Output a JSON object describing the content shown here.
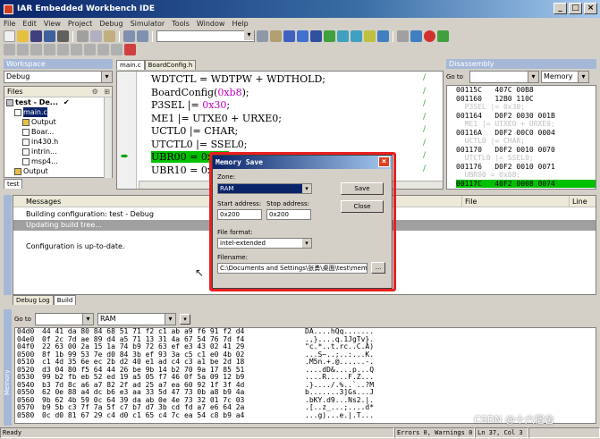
{
  "window": {
    "title": "IAR Embedded Workbench IDE"
  },
  "menu": [
    "File",
    "Edit",
    "View",
    "Project",
    "Debug",
    "Simulator",
    "Tools",
    "Window",
    "Help"
  ],
  "workspace": {
    "title": "Workspace",
    "config": "Debug",
    "files_header": "Files",
    "tree": [
      {
        "label": "test - De...",
        "indent": 0,
        "icon": "project-icon",
        "check": "✔"
      },
      {
        "label": "main.c",
        "indent": 1,
        "icon": "file-icon",
        "selected": true
      },
      {
        "label": "Output",
        "indent": 2,
        "icon": "folder-icon"
      },
      {
        "label": "Boar...",
        "indent": 2,
        "icon": "file-icon"
      },
      {
        "label": "in430.h",
        "indent": 2,
        "icon": "file-icon"
      },
      {
        "label": "intrin...",
        "indent": 2,
        "icon": "file-icon"
      },
      {
        "label": "msp4...",
        "indent": 2,
        "icon": "file-icon"
      },
      {
        "label": "Output",
        "indent": 1,
        "icon": "folder-icon"
      }
    ],
    "bottom_tab": "test"
  },
  "editor": {
    "tabs": [
      "main.c",
      "BoardConfig.h"
    ],
    "lines": [
      {
        "pre": "WDTCTL = WDTPW + WDTHOLD;",
        "num": "",
        "post": ""
      },
      {
        "pre": "BoardConfig(",
        "num": "0xb8",
        "post": ");"
      },
      {
        "pre": "P3SEL |= ",
        "num": "0x30",
        "post": ";"
      },
      {
        "pre": "ME1 |= UTXE0 + URXE0;",
        "num": "",
        "post": ""
      },
      {
        "pre": "UCTL0 |= CHAR;",
        "num": "",
        "post": ""
      },
      {
        "pre": "UTCTL0 |= SSEL0;",
        "num": "",
        "post": ""
      },
      {
        "pre": "UBR00 = 0x08;",
        "num": "",
        "post": ""
      },
      {
        "pre": "UBR10 = 0x00;",
        "num": "",
        "post": ""
      }
    ]
  },
  "disassembly": {
    "title": "Disassembly",
    "goto_label": "Go to",
    "memory_label": "Memory",
    "lines": [
      {
        "text": "00115C   407C 00B8",
        "kind": "code"
      },
      {
        "text": "001160   12B0 110C",
        "kind": "code"
      },
      {
        "text": "  P3SEL |= 0x30;",
        "kind": "src"
      },
      {
        "text": "001164   D0F2 0030 001B",
        "kind": "code"
      },
      {
        "text": "  ME1 |= UTXE0 + URXE0;",
        "kind": "src"
      },
      {
        "text": "00116A   D0F2 00C0 0004",
        "kind": "code"
      },
      {
        "text": "  UCTL0 |= CHAR;",
        "kind": "src"
      },
      {
        "text": "001170   D0F2 0010 0070",
        "kind": "code"
      },
      {
        "text": "  UTCTL0 |= SSEL0;",
        "kind": "src"
      },
      {
        "text": "001176   D0F2 0010 0071",
        "kind": "code"
      },
      {
        "text": "  UBR00 = 0x08;",
        "kind": "src"
      },
      {
        "text": "00117C   40F2 0008 0074",
        "kind": "hl"
      }
    ]
  },
  "messages": {
    "header": "Messages",
    "file_col": "File",
    "line_col": "Line",
    "rows": [
      {
        "text": "Building configuration: test - Debug",
        "highlight": false
      },
      {
        "text": "Updating build tree...",
        "highlight": true
      },
      {
        "text": "",
        "highlight": false
      },
      {
        "text": "Configuration is up-to-date.",
        "highlight": false
      }
    ],
    "tabs": [
      "Debug Log",
      "Build"
    ],
    "side_label": "Messages"
  },
  "dialog": {
    "title": "Memory Save",
    "zone_label": "Zone:",
    "zone_value": "RAM",
    "save_button": "Save",
    "close_button": "Close",
    "start_label": "Start address:",
    "start_value": "0x200",
    "stop_label": "Stop address:",
    "stop_value": "0x200",
    "format_label": "File format:",
    "format_value": "intel-extended",
    "filename_label": "Filename:",
    "filename_value": "C:\\Documents and Settings\\张勇\\桌面\\test\\memory.",
    "browse_button": "..."
  },
  "memory": {
    "goto_label": "Go to",
    "zone": "RAM",
    "side_label": "Memory",
    "lines": [
      {
        "addr": "04d0",
        "hex": "44 41 da 80 84 68 51 71 f2 c1 ab a9 f6 91 f2 d4",
        "ascii": "DA....hQq......."
      },
      {
        "addr": "04e0",
        "hex": "0f 2c 7d ae 89 d4 a5 71 13 31 4a 67 54 76 7d f4",
        "ascii": ".,}....q.1JgTv}."
      },
      {
        "addr": "04f0",
        "hex": "22 63 00 2a 15 1a 74 b9 72 63 ef e3 43 02 41 29",
        "ascii": "\"c.*..t.rc..C.A)"
      },
      {
        "addr": "0500",
        "hex": "8f 1b 99 53 7e d0 84 3b ef 93 3a c5 c1 e0 4b 02",
        "ascii": "...S~..;..:...K."
      },
      {
        "addr": "0510",
        "hex": "c1 4d 35 6e ec 2b d2 40 e1 ad c4 c3 a1 be 2d 18",
        "ascii": ".M5n.+.@......-."
      },
      {
        "addr": "0520",
        "hex": "d3 04 80 f5 64 44 26 be 9b 14 b2 70 9a 17 85 51",
        "ascii": "....dD&....p...Q"
      },
      {
        "addr": "0530",
        "hex": "99 b2 fb eb 52 ed 19 a5 05 f7 46 0f 5a 09 12 b9",
        "ascii": "....R.....F.Z..."
      },
      {
        "addr": "0540",
        "hex": "b3 7d 8c a6 a7 82 2f ad 25 a7 ea 60 92 1f 3f 4d",
        "ascii": ".}..../.%..`..?M"
      },
      {
        "addr": "0550",
        "hex": "62 0e 88 a4 dc b6 e3 aa 33 5d 47 73 0b a8 b9 4a",
        "ascii": "b.......3]Gs...J"
      },
      {
        "addr": "0560",
        "hex": "9b 62 4b 59 0c 64 39 da ab 0e 4e 73 32 01 7c 03",
        "ascii": ".bKY.d9...Ns2.|."
      },
      {
        "addr": "0570",
        "hex": "b9 5b c3 7f 7a 5f c7 b7 d7 3b cd fd a7 e6 64 2a",
        "ascii": ".[..z_...;....d*"
      },
      {
        "addr": "0580",
        "hex": "0c d0 81 67 29 c4 d0 c1 65 c4 7c ea 54 c8 b9 a4",
        "ascii": "...g)...e.|.T..."
      }
    ]
  },
  "status": {
    "ready": "Ready",
    "errors": "Errors 0, Warnings 0",
    "position": "Ln 37, Col 3"
  },
  "watermark": "CSDN @十六宿舍",
  "colors": {
    "highlight_green": "#00c000",
    "dialog_outline": "#e82020",
    "title_blue": "#0a246a"
  }
}
